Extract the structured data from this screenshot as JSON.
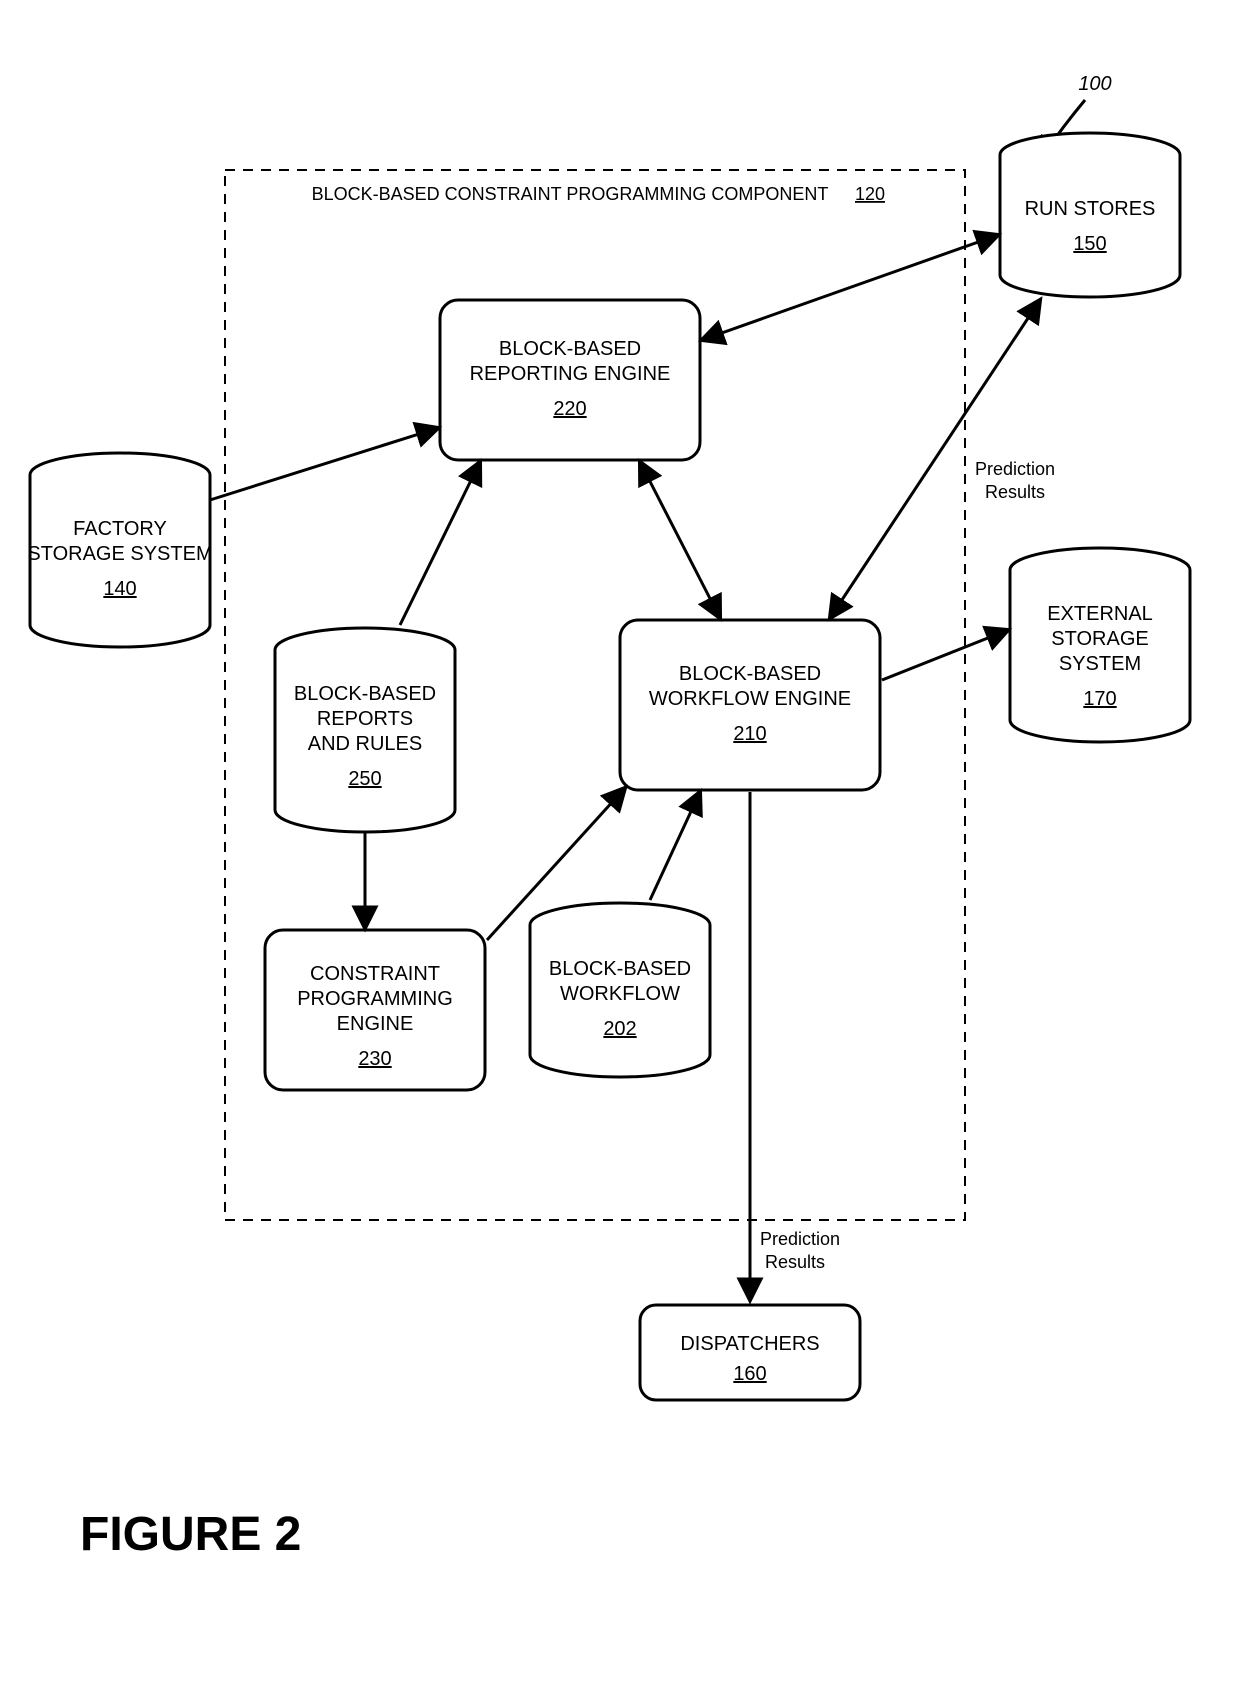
{
  "figure_label": "FIGURE 2",
  "system_ref": "100",
  "container": {
    "title": "BLOCK-BASED CONSTRAINT PROGRAMMING COMPONENT",
    "ref": "120"
  },
  "nodes": {
    "factory": {
      "label1": "FACTORY",
      "label2": "STORAGE SYSTEM",
      "ref": "140"
    },
    "run_stores": {
      "label1": "RUN STORES",
      "ref": "150"
    },
    "ext_storage": {
      "label1": "EXTERNAL",
      "label2": "STORAGE",
      "label3": "SYSTEM",
      "ref": "170"
    },
    "dispatchers": {
      "label1": "DISPATCHERS",
      "ref": "160"
    },
    "reports_rules": {
      "label1": "BLOCK-BASED",
      "label2": "REPORTS",
      "label3": "AND RULES",
      "ref": "250"
    },
    "workflow_store": {
      "label1": "BLOCK-BASED",
      "label2": "WORKFLOW",
      "ref": "202"
    },
    "reporting_eng": {
      "label1": "BLOCK-BASED",
      "label2": "REPORTING ENGINE",
      "ref": "220"
    },
    "workflow_eng": {
      "label1": "BLOCK-BASED",
      "label2": "WORKFLOW ENGINE",
      "ref": "210"
    },
    "constraint_eng": {
      "label1": "CONSTRAINT",
      "label2": "PROGRAMMING",
      "label3": "ENGINE",
      "ref": "230"
    }
  },
  "edge_labels": {
    "pred1a": "Prediction",
    "pred1b": "Results",
    "pred2a": "Prediction",
    "pred2b": "Results"
  }
}
